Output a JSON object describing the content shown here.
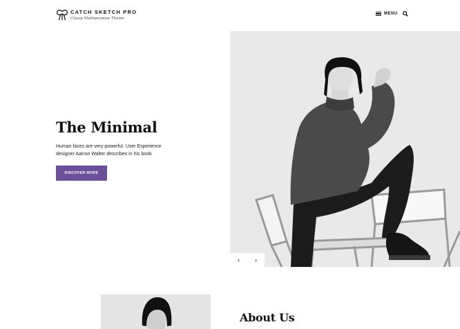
{
  "site": {
    "title": "CATCH SKETCH PRO",
    "tagline": "Classy Multipurpose Theme"
  },
  "nav": {
    "menu_label": "MENU",
    "menu_icon": "hamburger-icon",
    "search_icon": "search-icon"
  },
  "hero": {
    "title": "The Minimal",
    "description": "Human faces are very powerful. User Experience designer Aarron Walter describes in his book",
    "cta_label": "DISCOVER MORE",
    "cta_color": "#6b4f9a",
    "prev_label": "‹",
    "next_label": "›"
  },
  "about": {
    "title": "About Us"
  }
}
